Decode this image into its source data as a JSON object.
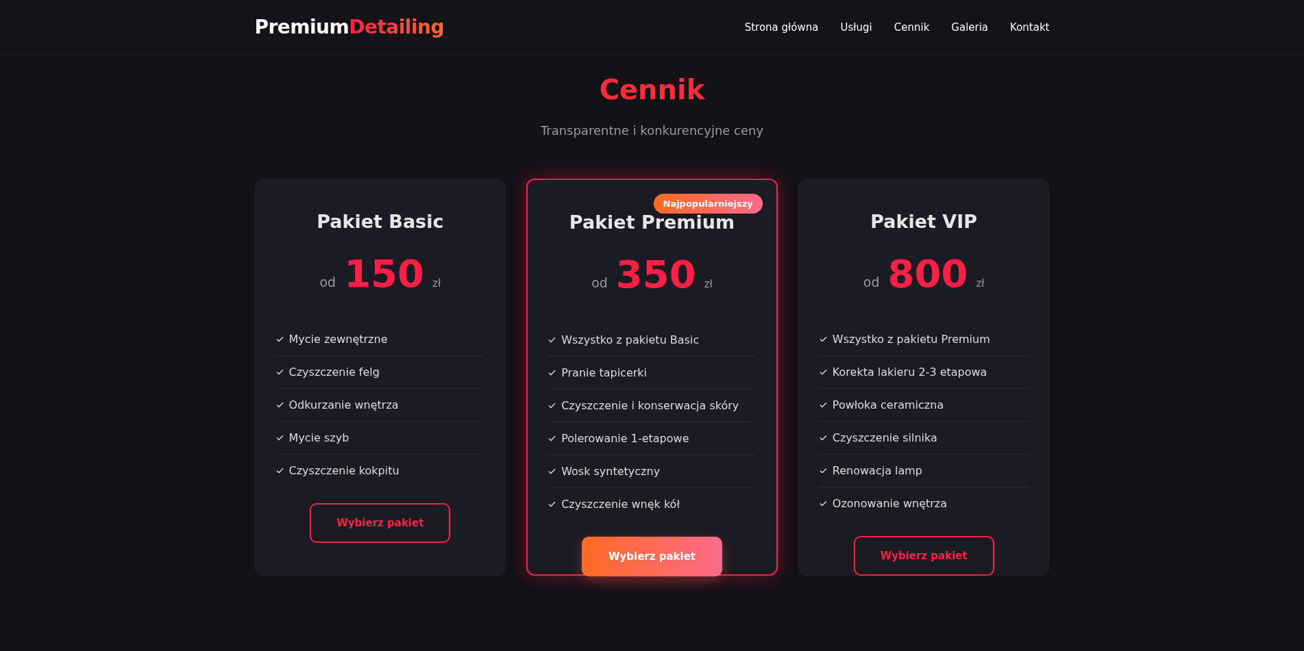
{
  "logo": {
    "first": "Premium",
    "second": "Detailing"
  },
  "nav": [
    {
      "label": "Strona główna"
    },
    {
      "label": "Usługi"
    },
    {
      "label": "Cennik"
    },
    {
      "label": "Galeria"
    },
    {
      "label": "Kontakt"
    }
  ],
  "heading": "Cennik",
  "subheading": "Transparentne i konkurencyjne ceny",
  "plans": [
    {
      "name": "Pakiet Basic",
      "featured": false,
      "prefix": "od",
      "price": "150",
      "currency": "zł",
      "features": [
        "Mycie zewnętrzne",
        "Czyszczenie felg",
        "Odkurzanie wnętrza",
        "Mycie szyb",
        "Czyszczenie kokpitu"
      ],
      "button": "Wybierz pakiet"
    },
    {
      "name": "Pakiet Premium",
      "featured": true,
      "badge": "Najpopularniejszy",
      "prefix": "od",
      "price": "350",
      "currency": "zł",
      "features": [
        "Wszystko z pakietu Basic",
        "Pranie tapicerki",
        "Czyszczenie i konserwacja skóry",
        "Polerowanie 1-etapowe",
        "Wosk syntetyczny",
        "Czyszczenie wnęk kół"
      ],
      "button": "Wybierz pakiet"
    },
    {
      "name": "Pakiet VIP",
      "featured": false,
      "prefix": "od",
      "price": "800",
      "currency": "zł",
      "features": [
        "Wszystko z pakietu Premium",
        "Korekta lakieru 2-3 etapowa",
        "Powłoka ceramiczna",
        "Czyszczenie silnika",
        "Renowacja lamp",
        "Ozonowanie wnętrza"
      ],
      "button": "Wybierz pakiet"
    }
  ]
}
